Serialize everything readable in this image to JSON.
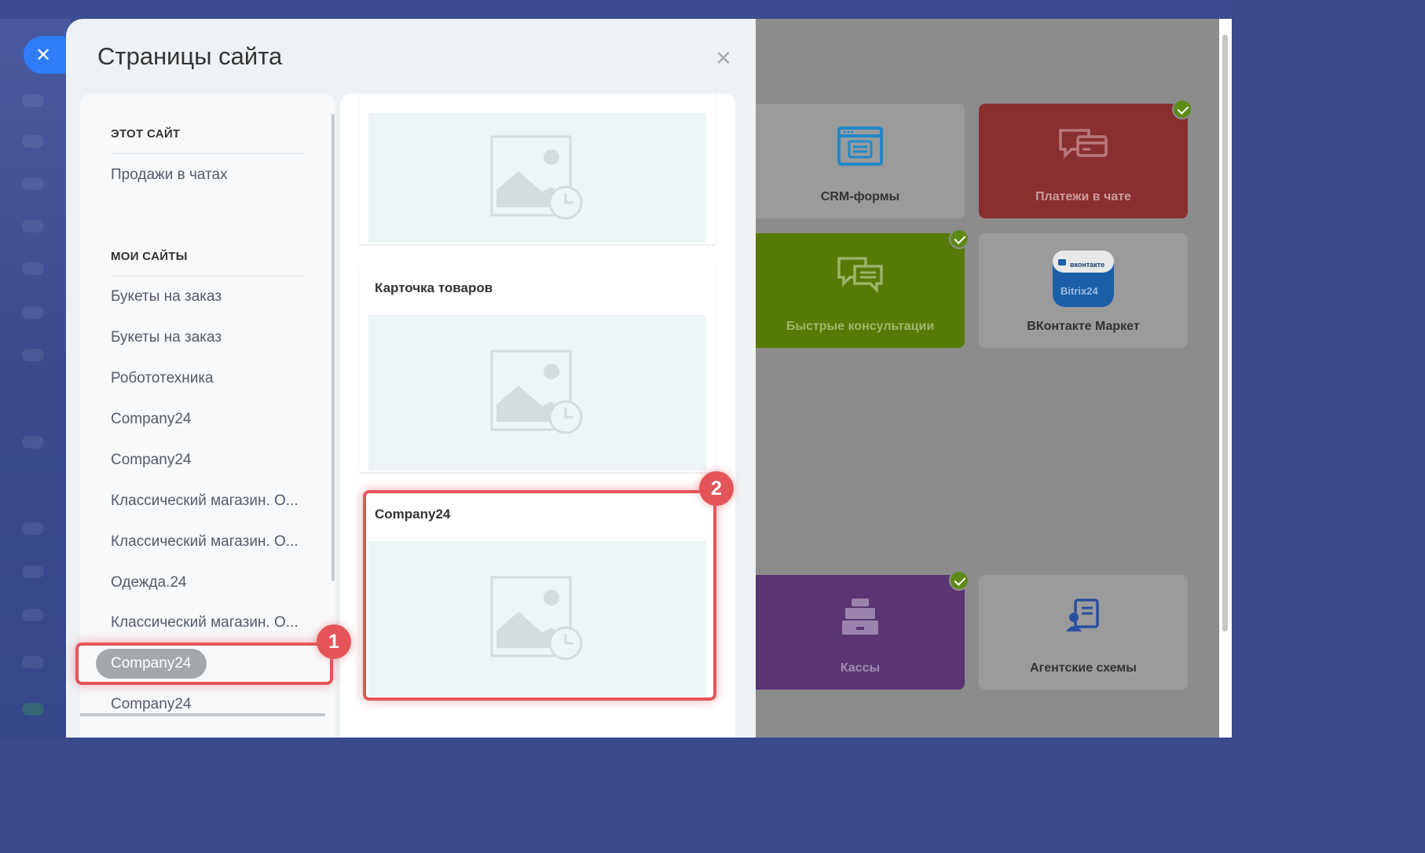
{
  "panel": {
    "title": "Страницы сайта"
  },
  "sidebar": {
    "this_site_title": "ЭТОТ САЙТ",
    "this_site_items": [
      "Продажи в чатах"
    ],
    "my_sites_title": "МОИ САЙТЫ",
    "my_sites_items": [
      "Букеты на заказ",
      "Букеты на заказ",
      "Робототехника",
      "Company24",
      "Company24",
      "Классический магазин. О...",
      "Классический магазин. О...",
      "Одежда.24",
      "Классический магазин. О...",
      "Company24",
      "Company24"
    ],
    "selected_index": 9
  },
  "cards": [
    {
      "title": ""
    },
    {
      "title": "Карточка товаров"
    },
    {
      "title": "Company24"
    }
  ],
  "tiles": [
    {
      "label": "CRM-формы",
      "color": "#9b9b9b",
      "icon": "crm-form-icon",
      "checked": false
    },
    {
      "label": "Платежи в чате",
      "color": "#8a2f2f",
      "icon": "chat-payment-icon",
      "checked": true
    },
    {
      "label": "Быстрые консультации",
      "color": "#567a05",
      "icon": "chat-bubbles-icon",
      "checked": true
    },
    {
      "label": "ВКонтакте Маркет",
      "color": "#9b9b9b",
      "icon": "vk-bitrix-icon",
      "checked": false,
      "icon_text_top": "вконтакте",
      "icon_text_bottom": "Bitrix24"
    },
    {
      "label": "Кассы",
      "color": "#5b3573",
      "icon": "cash-register-icon",
      "checked": true
    },
    {
      "label": "Агентские схемы",
      "color": "#9b9b9b",
      "icon": "agent-scheme-icon",
      "checked": false
    }
  ],
  "badges": {
    "one": "1",
    "two": "2"
  },
  "colors": {
    "accent": "#2f7df6",
    "highlight": "#e4555a"
  }
}
